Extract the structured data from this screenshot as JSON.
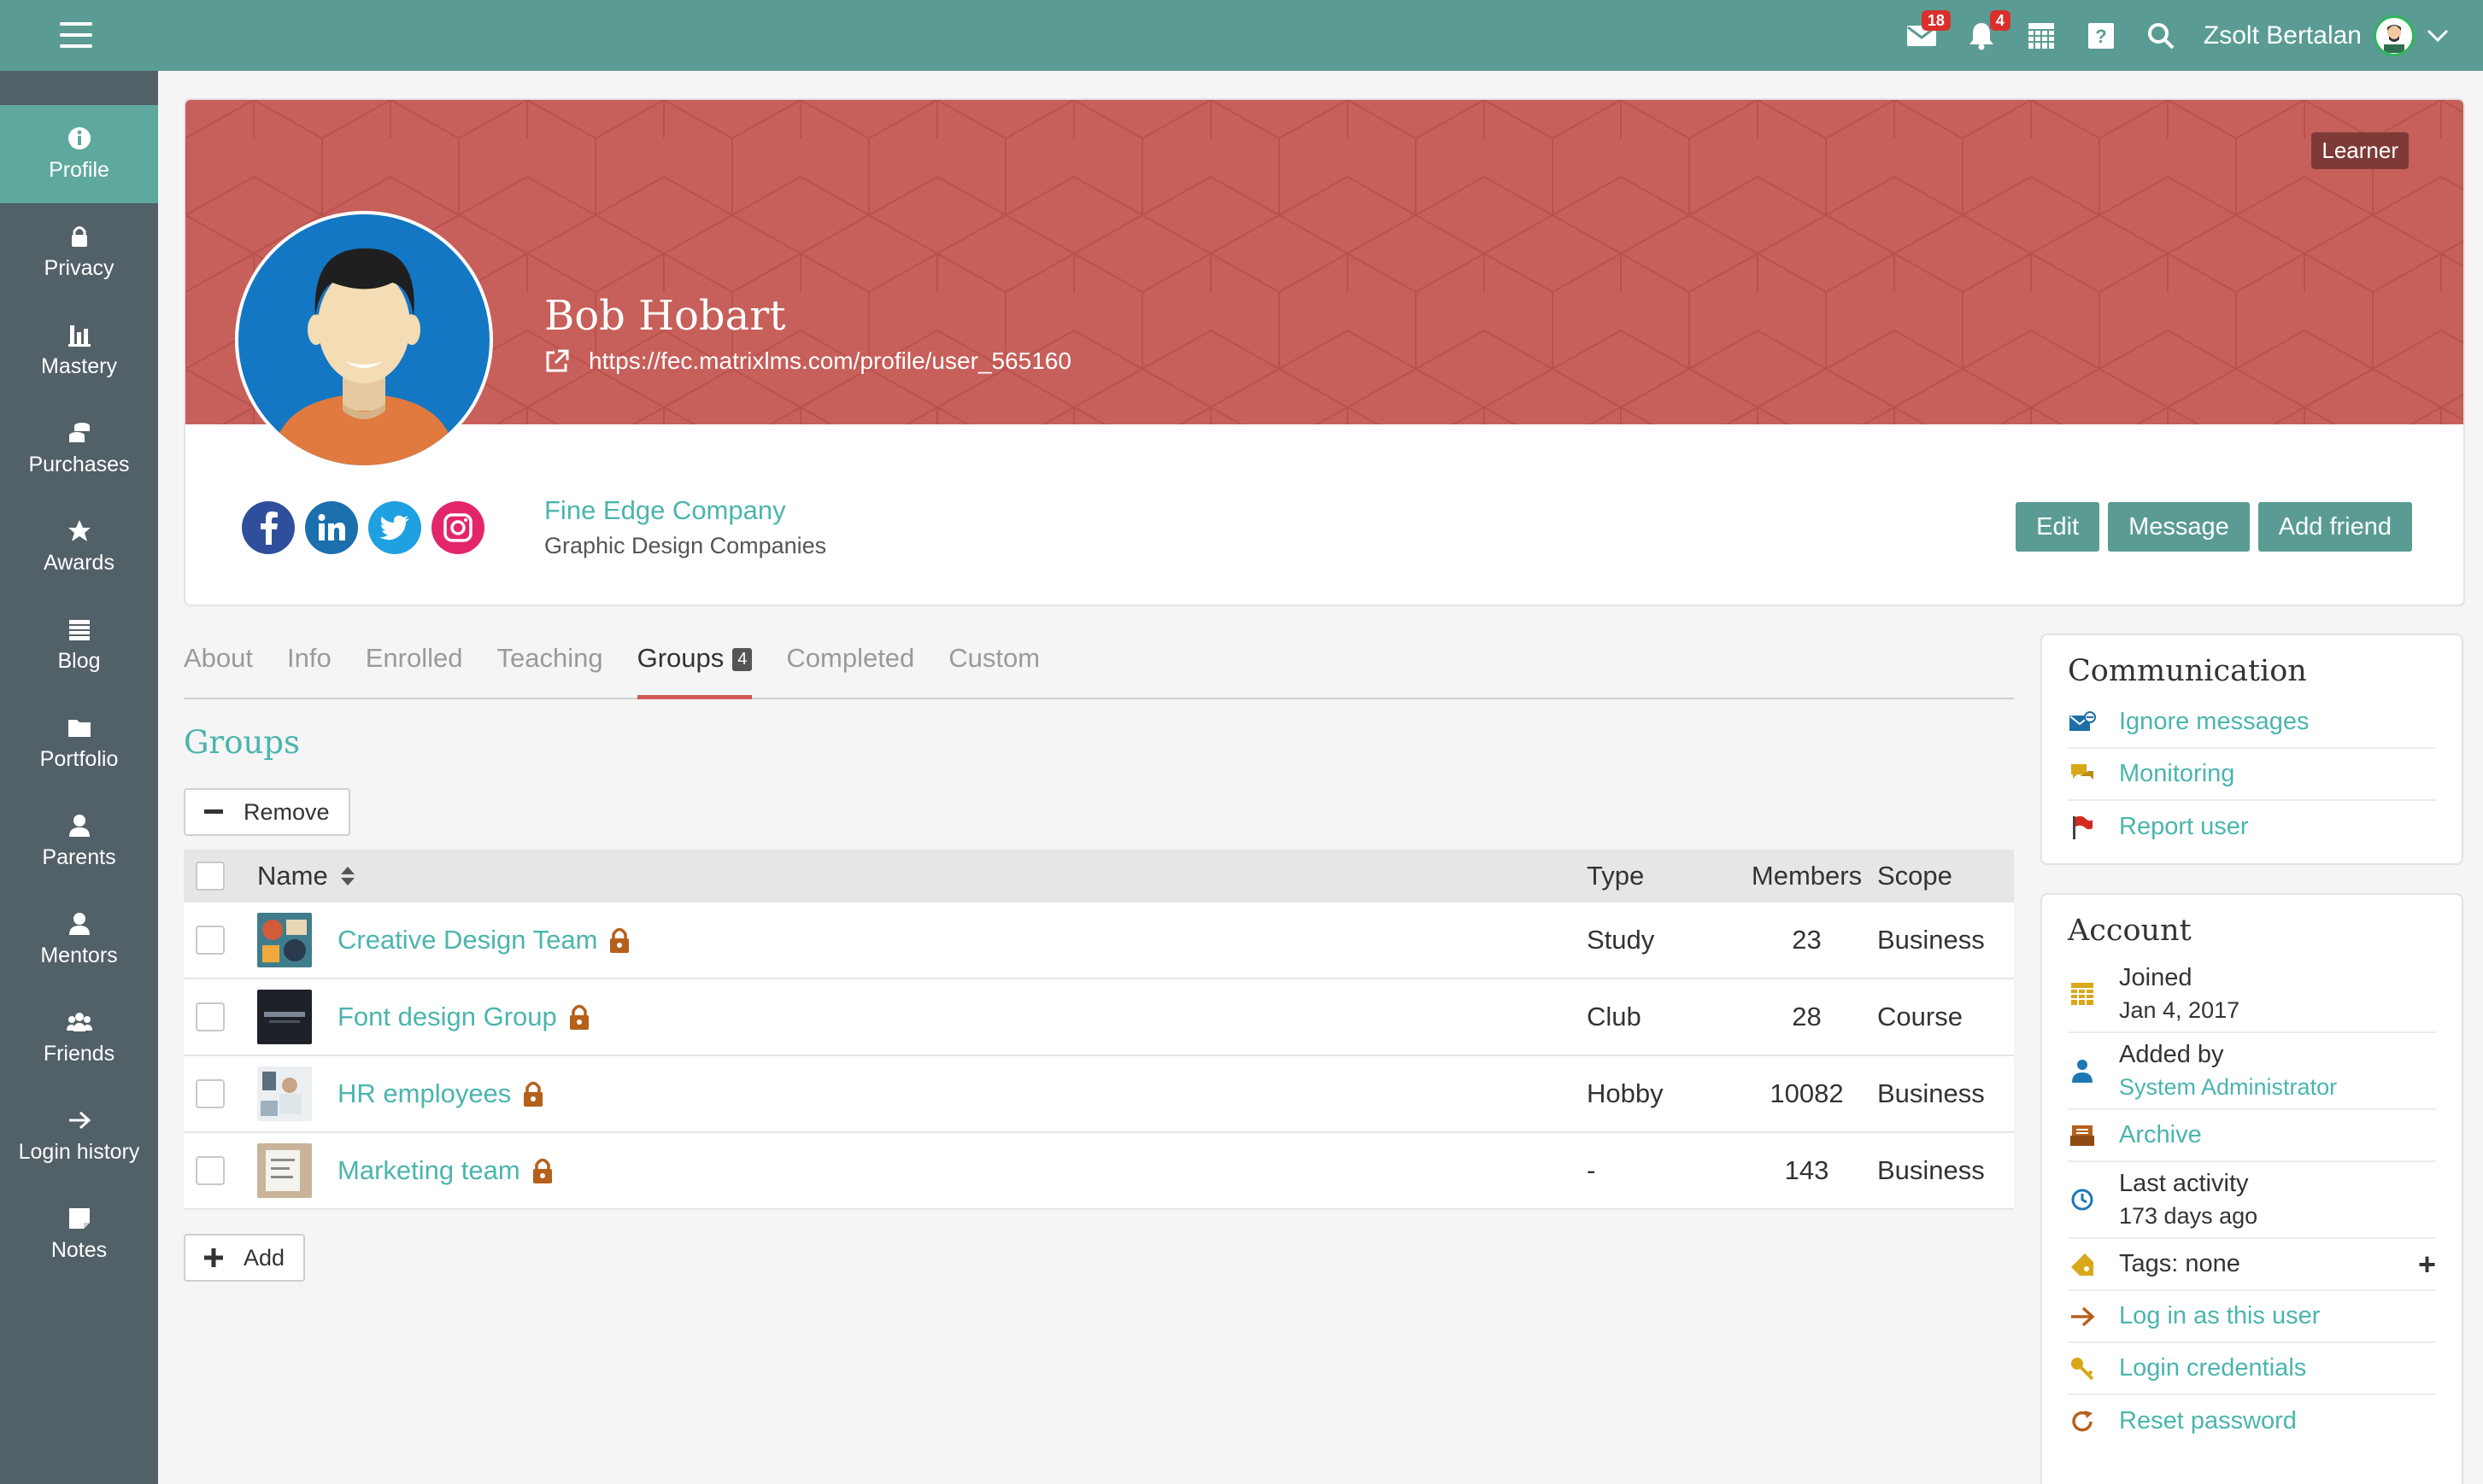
{
  "topbar": {
    "messages_count": "18",
    "notifications_count": "4",
    "user_name": "Zsolt Bertalan"
  },
  "sidebar": {
    "items": [
      {
        "label": "Profile",
        "icon": "info-icon"
      },
      {
        "label": "Privacy",
        "icon": "lock-icon"
      },
      {
        "label": "Mastery",
        "icon": "bar-chart-icon"
      },
      {
        "label": "Purchases",
        "icon": "coins-icon"
      },
      {
        "label": "Awards",
        "icon": "star-icon"
      },
      {
        "label": "Blog",
        "icon": "calendar-icon"
      },
      {
        "label": "Portfolio",
        "icon": "folder-icon"
      },
      {
        "label": "Parents",
        "icon": "person-icon"
      },
      {
        "label": "Mentors",
        "icon": "person-icon"
      },
      {
        "label": "Friends",
        "icon": "users-icon"
      },
      {
        "label": "Login history",
        "icon": "arrow-right-icon"
      },
      {
        "label": "Notes",
        "icon": "note-icon"
      }
    ]
  },
  "profile": {
    "role_badge": "Learner",
    "name": "Bob Hobart",
    "url": "https://fec.matrixlms.com/profile/user_565160",
    "company": "Fine Edge Company",
    "company_category": "Graphic Design Companies",
    "actions": {
      "edit": "Edit",
      "message": "Message",
      "add_friend": "Add friend"
    }
  },
  "tabs": [
    {
      "label": "About"
    },
    {
      "label": "Info"
    },
    {
      "label": "Enrolled"
    },
    {
      "label": "Teaching"
    },
    {
      "label": "Groups",
      "count": "4",
      "active": true
    },
    {
      "label": "Completed"
    },
    {
      "label": "Custom"
    }
  ],
  "groups": {
    "title": "Groups",
    "remove_label": "Remove",
    "add_label": "Add",
    "columns": {
      "name": "Name",
      "type": "Type",
      "members": "Members",
      "scope": "Scope"
    },
    "rows": [
      {
        "name": "Creative Design Team",
        "type": "Study",
        "members": "23",
        "scope": "Business"
      },
      {
        "name": "Font design Group",
        "type": "Club",
        "members": "28",
        "scope": "Course"
      },
      {
        "name": "HR employees",
        "type": "Hobby",
        "members": "10082",
        "scope": "Business"
      },
      {
        "name": "Marketing team",
        "type": "-",
        "members": "143",
        "scope": "Business"
      }
    ]
  },
  "communication": {
    "title": "Communication",
    "ignore": "Ignore messages",
    "monitoring": "Monitoring",
    "report": "Report user"
  },
  "account": {
    "title": "Account",
    "joined_label": "Joined",
    "joined_value": "Jan 4, 2017",
    "added_by_label": "Added by",
    "added_by_value": "System Administrator",
    "archive": "Archive",
    "last_activity_label": "Last activity",
    "last_activity_value": "173 days ago",
    "tags": "Tags: none",
    "login_as": "Log in as this user",
    "credentials": "Login credentials",
    "reset_password": "Reset password"
  },
  "colors": {
    "topbar": "#5a9c93",
    "sidebar": "#526067",
    "banner": "#c75f5a",
    "accent": "#4ab5ad",
    "tab_underline": "#d15b54"
  }
}
